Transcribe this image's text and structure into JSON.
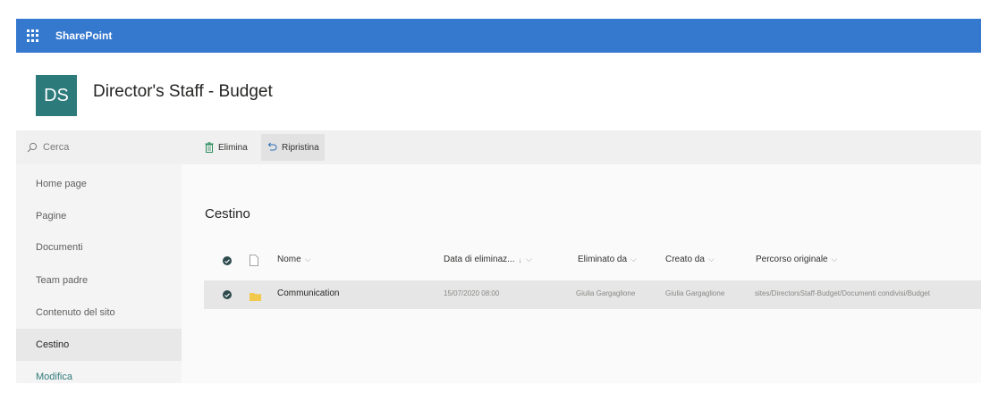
{
  "topbar": {
    "app_name": "SharePoint"
  },
  "site": {
    "logo_initials": "DS",
    "title": "Director's Staff - Budget"
  },
  "sidebar": {
    "search_placeholder": "Cerca",
    "items": [
      {
        "label": "Home page"
      },
      {
        "label": "Pagine"
      },
      {
        "label": "Documenti"
      },
      {
        "label": "Team padre"
      },
      {
        "label": "Contenuto del sito"
      },
      {
        "label": "Cestino"
      },
      {
        "label": "Modifica"
      }
    ],
    "selected": "Cestino"
  },
  "commandbar": {
    "delete_label": "Elimina",
    "restore_label": "Ripristina"
  },
  "main": {
    "heading": "Cestino",
    "columns": {
      "name": "Nome",
      "deleted_date": "Data di eliminaz...",
      "deleted_by": "Eliminato da",
      "created_by": "Creato da",
      "original_path": "Percorso originale"
    },
    "rows": [
      {
        "name": "Communication",
        "deleted_date": "15/07/2020 08:00",
        "deleted_by": "Giulia Gargaglione",
        "created_by": "Giulia Gargaglione",
        "original_path": "sites/DirectorsStaff-Budget/Documenti condivisi/Budget"
      }
    ]
  },
  "colors": {
    "suite_bar": "#3579cf",
    "logo_bg": "#2c7a7a",
    "check": "#2d4a4d",
    "folder": "#f2c94c"
  }
}
